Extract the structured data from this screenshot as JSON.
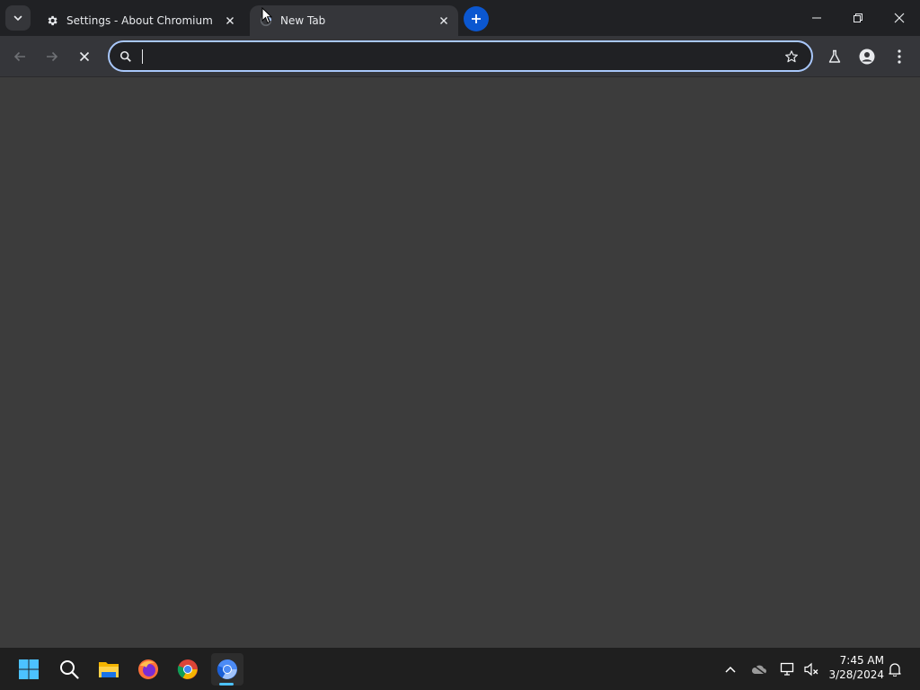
{
  "tabs": [
    {
      "title": "Settings - About Chromium",
      "favicon": "gear-icon",
      "active": false
    },
    {
      "title": "New Tab",
      "favicon": "loading-icon",
      "active": true
    }
  ],
  "omnibox": {
    "value": "",
    "placeholder": ""
  },
  "clock": {
    "time": "7:45 AM",
    "date": "3/28/2024"
  },
  "taskbar_apps": [
    "windows-start-icon",
    "search-icon",
    "file-explorer-icon",
    "firefox-icon",
    "chrome-icon",
    "chromium-icon"
  ],
  "colors": {
    "accent": "#0b57d0",
    "omnibox_focus": "#a8c7fa",
    "taskbar_indicator": "#4cc2ff"
  }
}
